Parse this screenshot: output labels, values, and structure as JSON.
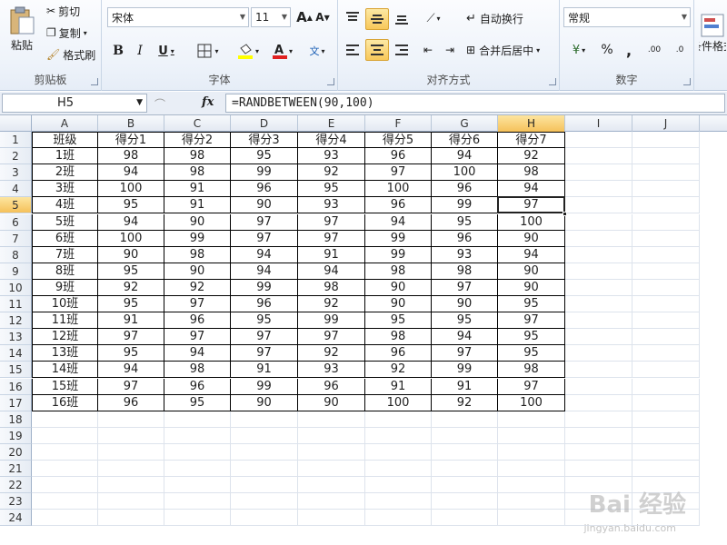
{
  "ribbon": {
    "clipboard": {
      "label": "剪贴板",
      "paste": "粘贴",
      "cut": "剪切",
      "copy": "复制",
      "format_painter": "格式刷"
    },
    "font": {
      "label": "字体",
      "name": "宋体",
      "size": "11",
      "grow": "A",
      "shrink": "A",
      "bold": "B",
      "italic": "I",
      "underline": "U"
    },
    "align": {
      "label": "对齐方式",
      "wrap": "自动换行",
      "merge": "合并后居中"
    },
    "number": {
      "label": "数字",
      "format": "常规",
      "percent": "%",
      "comma": ",",
      "inc_decimal": ".00",
      "dec_decimal": ".0"
    },
    "styles": {
      "conditional": "条件格式"
    }
  },
  "formula_bar": {
    "name_box": "H5",
    "fx": "fx",
    "formula": "=RANDBETWEEN(90,100)"
  },
  "columns": [
    "A",
    "B",
    "C",
    "D",
    "E",
    "F",
    "G",
    "H",
    "I",
    "J"
  ],
  "selected_column": "H",
  "selected_row": "5",
  "rows": [
    "1",
    "2",
    "3",
    "4",
    "5",
    "6",
    "7",
    "8",
    "9",
    "10",
    "11",
    "12",
    "13",
    "14",
    "15",
    "16",
    "17",
    "18",
    "19",
    "20",
    "21",
    "22",
    "23",
    "24"
  ],
  "sheet": [
    [
      "班级",
      "得分1",
      "得分2",
      "得分3",
      "得分4",
      "得分5",
      "得分6",
      "得分7"
    ],
    [
      "1班",
      "98",
      "98",
      "95",
      "93",
      "96",
      "94",
      "92"
    ],
    [
      "2班",
      "94",
      "98",
      "99",
      "92",
      "97",
      "100",
      "98"
    ],
    [
      "3班",
      "100",
      "91",
      "96",
      "95",
      "100",
      "96",
      "94"
    ],
    [
      "4班",
      "95",
      "91",
      "90",
      "93",
      "96",
      "99",
      "97"
    ],
    [
      "5班",
      "94",
      "90",
      "97",
      "97",
      "94",
      "95",
      "100"
    ],
    [
      "6班",
      "100",
      "99",
      "97",
      "97",
      "99",
      "96",
      "90"
    ],
    [
      "7班",
      "90",
      "98",
      "94",
      "91",
      "99",
      "93",
      "94"
    ],
    [
      "8班",
      "95",
      "90",
      "94",
      "94",
      "98",
      "98",
      "90"
    ],
    [
      "9班",
      "92",
      "92",
      "99",
      "98",
      "90",
      "97",
      "90"
    ],
    [
      "10班",
      "95",
      "97",
      "96",
      "92",
      "90",
      "90",
      "95"
    ],
    [
      "11班",
      "91",
      "96",
      "95",
      "99",
      "95",
      "95",
      "97"
    ],
    [
      "12班",
      "97",
      "97",
      "97",
      "97",
      "98",
      "94",
      "95"
    ],
    [
      "13班",
      "95",
      "94",
      "97",
      "92",
      "96",
      "97",
      "95"
    ],
    [
      "14班",
      "94",
      "98",
      "91",
      "93",
      "92",
      "99",
      "98"
    ],
    [
      "15班",
      "97",
      "96",
      "99",
      "96",
      "91",
      "91",
      "97"
    ],
    [
      "16班",
      "96",
      "95",
      "90",
      "90",
      "100",
      "92",
      "100"
    ]
  ],
  "watermark": {
    "brand": "Bai 经验",
    "url": "jingyan.baidu.com"
  }
}
